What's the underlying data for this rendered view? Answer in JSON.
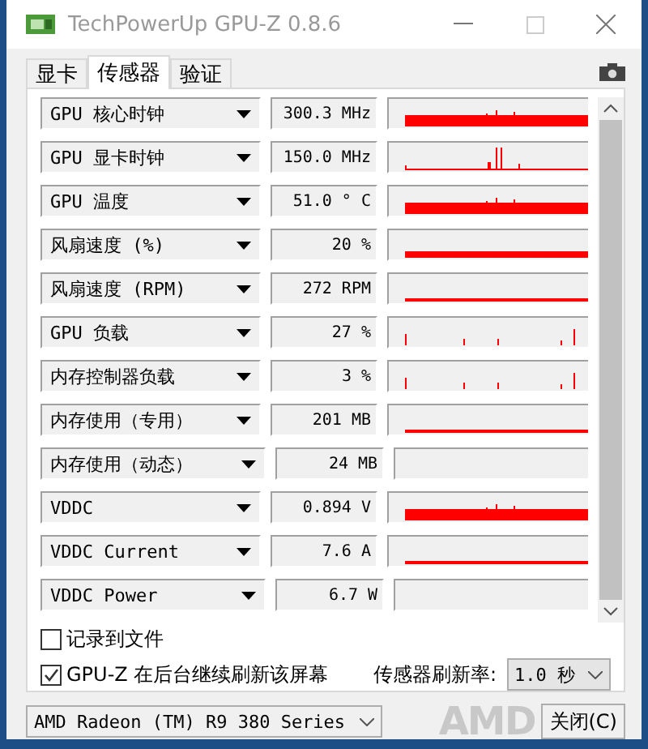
{
  "window": {
    "title": "TechPowerUp GPU-Z 0.8.6"
  },
  "tabs": [
    {
      "label": "显卡",
      "selected": false
    },
    {
      "label": "传感器",
      "selected": true
    },
    {
      "label": "验证",
      "selected": false
    }
  ],
  "sensors": [
    {
      "name": "GPU 核心时钟",
      "value": "300.3 MHz",
      "kind": "high"
    },
    {
      "name": "GPU 显卡时钟",
      "value": "150.0 MHz",
      "kind": "spikes"
    },
    {
      "name": "GPU 温度",
      "value": "51.0 ° C",
      "kind": "high"
    },
    {
      "name": "风扇速度 (%)",
      "value": "20 %",
      "kind": "low"
    },
    {
      "name": "风扇速度 (RPM)",
      "value": "272 RPM",
      "kind": "line"
    },
    {
      "name": "GPU 负载",
      "value": "27 %",
      "kind": "ticks"
    },
    {
      "name": "内存控制器负载",
      "value": "3 %",
      "kind": "ticks"
    },
    {
      "name": "内存使用（专用）",
      "value": "201 MB",
      "kind": "line"
    },
    {
      "name": "内存使用（动态）",
      "value": "24 MB",
      "kind": "flat"
    },
    {
      "name": "VDDC",
      "value": "0.894 V",
      "kind": "high"
    },
    {
      "name": "VDDC Current",
      "value": "7.6 A",
      "kind": "line"
    },
    {
      "name": "VDDC Power",
      "value": "6.7 W",
      "kind": "flat"
    }
  ],
  "options": [
    {
      "label": "记录到文件",
      "checked": false
    },
    {
      "label": "GPU-Z 在后台继续刷新该屏幕",
      "checked": true
    }
  ],
  "refresh": {
    "label": "传感器刷新率:",
    "value": "1.0 秒"
  },
  "device": {
    "value": "AMD Radeon (TM) R9 380 Series"
  },
  "vendor_logo": "AMD",
  "close_button": "关闭(C)"
}
